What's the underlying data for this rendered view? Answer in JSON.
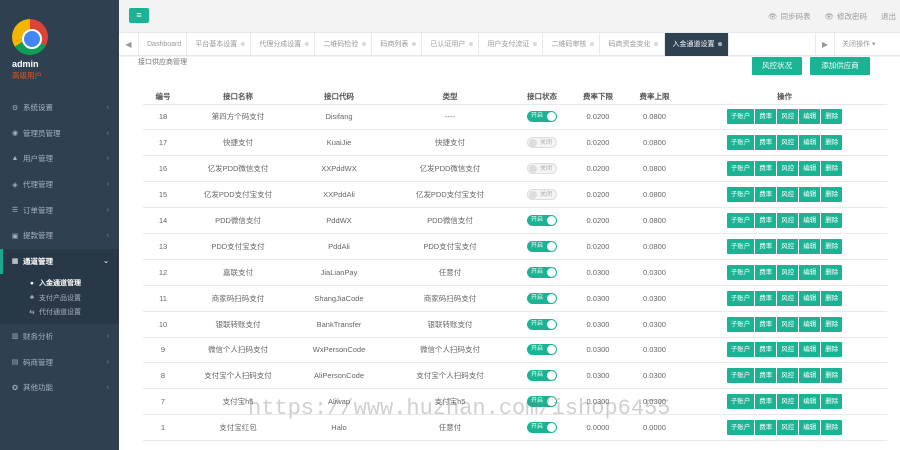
{
  "sidebar": {
    "username": "admin",
    "role": "高级用户",
    "nav": [
      {
        "label": "系统设置",
        "icon": "gears-icon",
        "glyph": "⚙"
      },
      {
        "label": "管理员管理",
        "icon": "user-circle-icon",
        "glyph": "◉"
      },
      {
        "label": "用户管理",
        "icon": "users-icon",
        "glyph": "▲"
      },
      {
        "label": "代理管理",
        "icon": "group-icon",
        "glyph": "◈"
      },
      {
        "label": "订单管理",
        "icon": "list-icon",
        "glyph": "☰"
      },
      {
        "label": "提款管理",
        "icon": "money-icon",
        "glyph": "▣"
      },
      {
        "label": "通道管理",
        "icon": "road-icon",
        "glyph": "▦"
      }
    ],
    "sub": [
      {
        "label": "入金通道管理",
        "icon": "circle-icon",
        "glyph": "●"
      },
      {
        "label": "支付产品设置",
        "icon": "sitemap-icon",
        "glyph": "♣"
      },
      {
        "label": "代付通道设置",
        "icon": "exchange-icon",
        "glyph": "⇆"
      }
    ],
    "nav2": [
      {
        "label": "财务分析",
        "icon": "chart-icon",
        "glyph": "▥"
      },
      {
        "label": "码商管理",
        "icon": "store-icon",
        "glyph": "▤"
      },
      {
        "label": "其他功能",
        "icon": "cog-icon",
        "glyph": "✪"
      }
    ]
  },
  "topbar": {
    "menu_glyph": "≡",
    "links": [
      {
        "label": "同步码表",
        "glyph": "👁"
      },
      {
        "label": "修改密码",
        "glyph": "👁"
      },
      {
        "label": "退出",
        "glyph": ""
      }
    ]
  },
  "tabs": {
    "items": [
      "Dashboard",
      "平台基本设置",
      "代理分成设置",
      "二维码检验",
      "码商列表",
      "已认证用户",
      "用户支付流证",
      "二维码审核",
      "码商资金变化",
      "入金通道设置"
    ],
    "active_index": 9,
    "ops_label": "关闭操作"
  },
  "content": {
    "title": "接口供应商管理",
    "risk_button": "风控状况",
    "add_button": "添加供应商"
  },
  "table": {
    "headers": [
      "编号",
      "接口名称",
      "接口代码",
      "类型",
      "接口状态",
      "费率下限",
      "费率上限",
      "操作"
    ],
    "on_label": "开启",
    "off_label": "关闭",
    "ops": [
      "子账户",
      "费率",
      "风控",
      "编辑",
      "删除"
    ],
    "rows": [
      {
        "id": "18",
        "name": "第四方个码支付",
        "code": "Disifang",
        "type": "----",
        "status": "on",
        "min": "0.0200",
        "max": "0.0800"
      },
      {
        "id": "17",
        "name": "快捷支付",
        "code": "KuaiJie",
        "type": "快捷支付",
        "status": "off",
        "min": "0.0200",
        "max": "0.0800"
      },
      {
        "id": "16",
        "name": "亿发PDD微信支付",
        "code": "XXPddWX",
        "type": "亿发PDD微信支付",
        "status": "off",
        "min": "0.0200",
        "max": "0.0800"
      },
      {
        "id": "15",
        "name": "亿发PDD支付宝支付",
        "code": "XXPddAli",
        "type": "亿发PDD支付宝支付",
        "status": "off",
        "min": "0.0200",
        "max": "0.0800"
      },
      {
        "id": "14",
        "name": "PDD微信支付",
        "code": "PddWX",
        "type": "PDD微信支付",
        "status": "on",
        "min": "0.0200",
        "max": "0.0800"
      },
      {
        "id": "13",
        "name": "PDD支付宝支付",
        "code": "PddAli",
        "type": "PDD支付宝支付",
        "status": "on",
        "min": "0.0200",
        "max": "0.0800"
      },
      {
        "id": "12",
        "name": "嘉联支付",
        "code": "JiaLianPay",
        "type": "任意付",
        "status": "on",
        "min": "0.0300",
        "max": "0.0300"
      },
      {
        "id": "11",
        "name": "商家码扫码支付",
        "code": "ShangJiaCode",
        "type": "商家码扫码支付",
        "status": "on",
        "min": "0.0300",
        "max": "0.0300"
      },
      {
        "id": "10",
        "name": "银联转账支付",
        "code": "BankTransfer",
        "type": "银联转账支付",
        "status": "on",
        "min": "0.0300",
        "max": "0.0300"
      },
      {
        "id": "9",
        "name": "微信个人扫码支付",
        "code": "WxPersonCode",
        "type": "微信个人扫码支付",
        "status": "on",
        "min": "0.0300",
        "max": "0.0300"
      },
      {
        "id": "8",
        "name": "支付宝个人扫码支付",
        "code": "AliPersonCode",
        "type": "支付宝个人扫码支付",
        "status": "on",
        "min": "0.0300",
        "max": "0.0300"
      },
      {
        "id": "7",
        "name": "支付宝h5",
        "code": "Aliwap",
        "type": "支付宝h5",
        "status": "on",
        "min": "0.0300",
        "max": "0.0300"
      },
      {
        "id": "1",
        "name": "支付宝红包",
        "code": "Halo",
        "type": "任意付",
        "status": "on",
        "min": "0.0000",
        "max": "0.0000"
      }
    ]
  },
  "watermark": "https://www.huzhan.com/ishop6455"
}
